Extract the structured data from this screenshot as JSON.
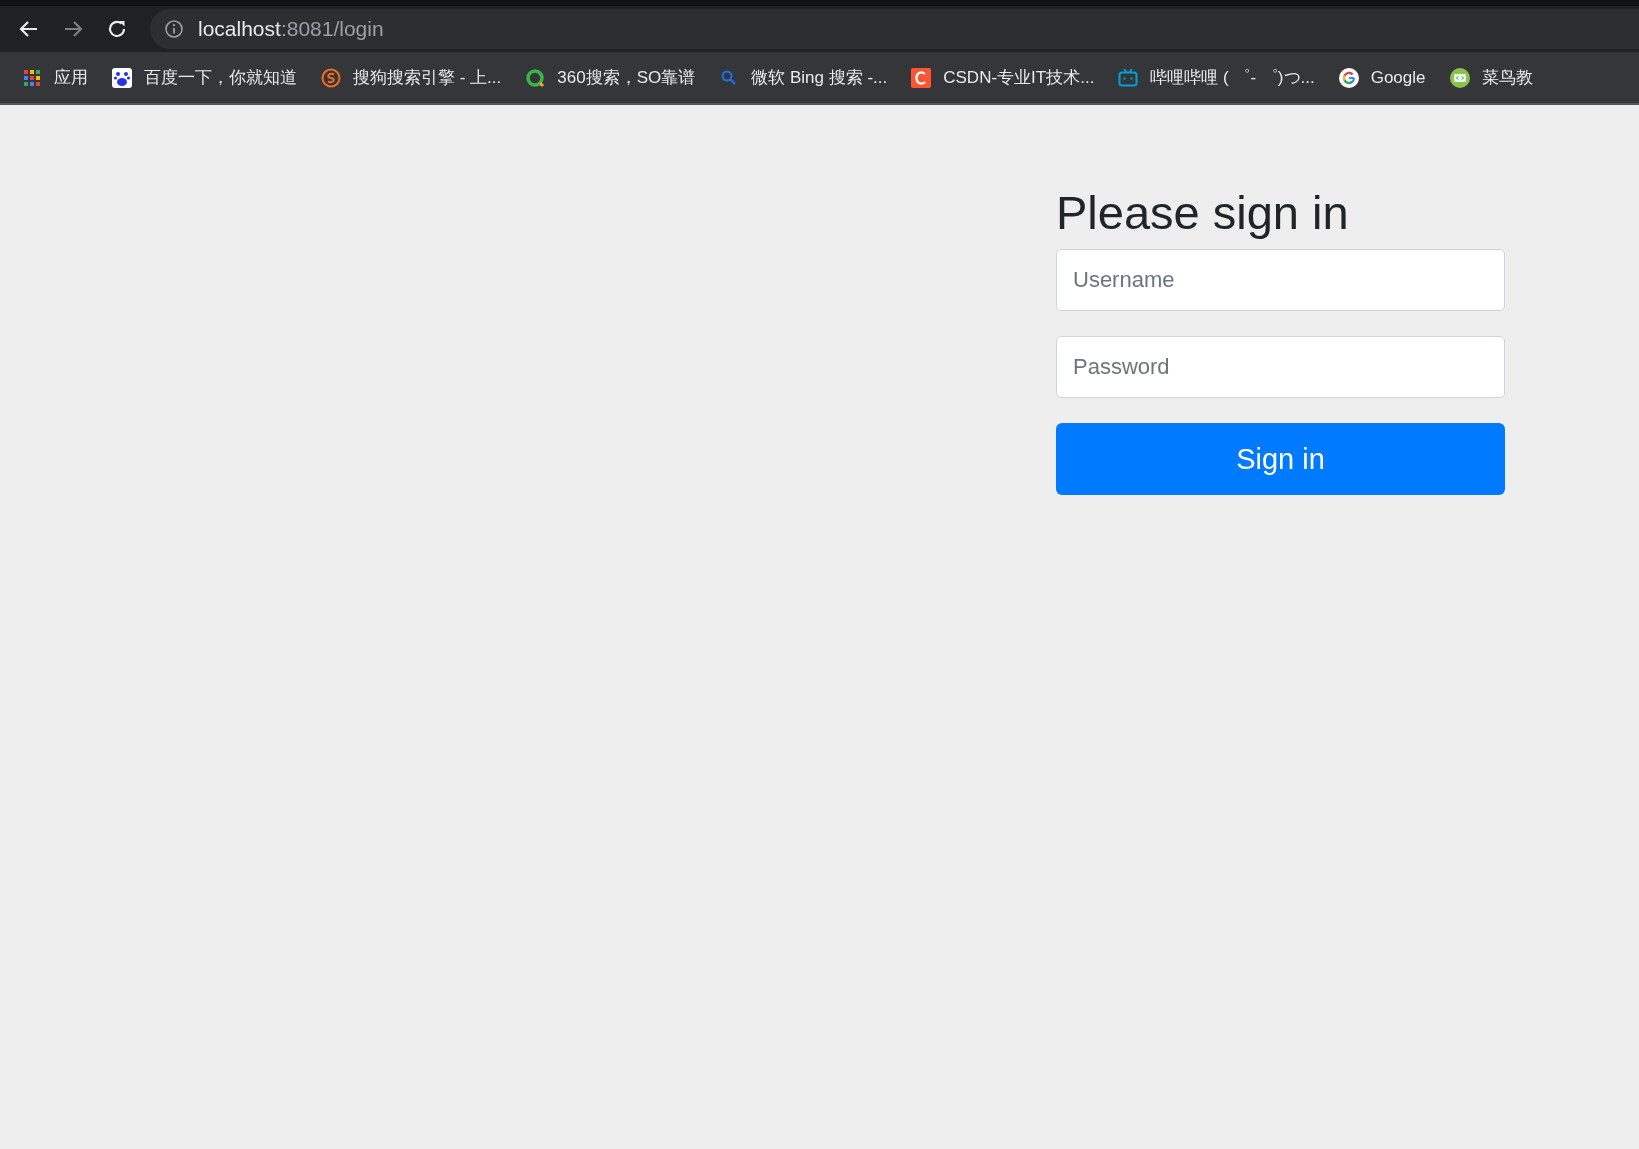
{
  "address_bar": {
    "host": "localhost",
    "path": ":8081/login"
  },
  "bookmarks": [
    {
      "kind": "apps",
      "label": "应用"
    },
    {
      "kind": "paw",
      "label": "百度一下，你就知道"
    },
    {
      "kind": "sogou",
      "label": "搜狗搜索引擎 - 上..."
    },
    {
      "kind": "ring",
      "label": "360搜索，SO靠谱"
    },
    {
      "kind": "search",
      "label": "微软 Bing 搜索 -..."
    },
    {
      "kind": "csdn",
      "label": "CSDN-专业IT技术..."
    },
    {
      "kind": "tv",
      "label": "哔哩哔哩 ( ゜- ゜)つ..."
    },
    {
      "kind": "google",
      "label": "Google"
    },
    {
      "kind": "web",
      "label": "菜鸟教"
    }
  ],
  "form": {
    "heading": "Please sign in",
    "username": {
      "placeholder": "Username"
    },
    "password": {
      "placeholder": "Password"
    },
    "button": "Sign in"
  }
}
